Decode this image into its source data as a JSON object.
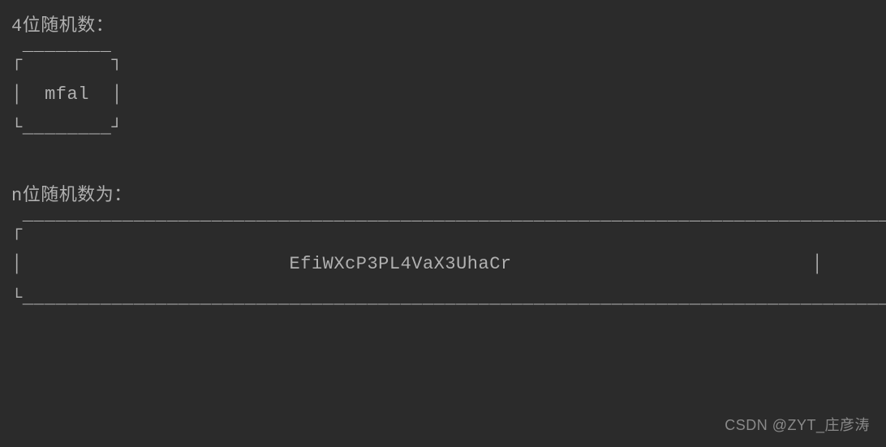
{
  "section1": {
    "title": "4位随机数：",
    "box_top": "┌‾‾‾‾‾‾‾‾┐",
    "box_middle": "│  mfal  │",
    "box_bottom": "└________┘",
    "value": "mfal"
  },
  "section2": {
    "title": "n位随机数为：",
    "box_top": "┌‾‾‾‾‾‾‾‾‾‾‾‾‾‾‾‾‾‾‾‾‾‾‾‾‾‾‾‾‾‾‾‾‾‾‾‾‾‾‾‾‾‾‾‾‾‾‾‾‾‾‾‾‾‾‾‾‾‾‾‾‾‾‾‾‾‾‾‾‾‾‾‾‾‾‾‾‾‾‾‾‾┐",
    "box_middle": "│                        EfiWXcP3PL4VaX3UhaCr                           │",
    "box_bottom": "└_________________________________________________________________________________┘",
    "value": "EfiWXcP3PL4VaX3UhaCr"
  },
  "watermark": "CSDN @ZYT_庄彦涛"
}
